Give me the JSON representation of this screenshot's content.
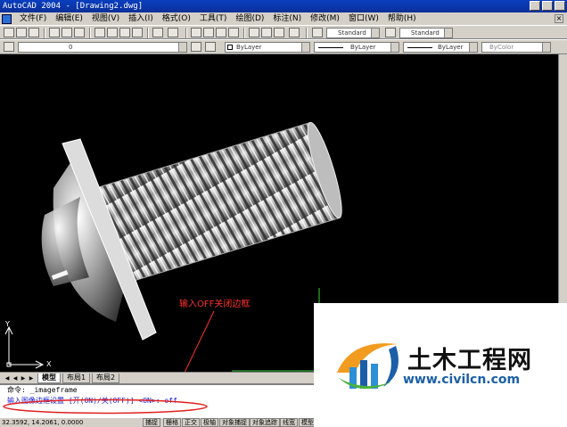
{
  "window": {
    "title": "AutoCAD 2004 - [Drawing2.dwg]"
  },
  "menu": [
    "文件(F)",
    "编辑(E)",
    "视图(V)",
    "插入(I)",
    "格式(O)",
    "工具(T)",
    "绘图(D)",
    "标注(N)",
    "修改(M)",
    "窗口(W)",
    "帮助(H)"
  ],
  "toolbar": {
    "text_style": "Standard",
    "dim_style": "Standard",
    "layer": "0",
    "color": "ByLayer",
    "linetype": "ByLayer",
    "lineweight": "ByLayer",
    "plotstyle": "ByColor"
  },
  "canvas": {
    "annotation": "输入OFF关闭边框",
    "ucs_x": "X",
    "ucs_y": "Y"
  },
  "tabs": [
    "模型",
    "布局1",
    "布局2"
  ],
  "command": {
    "line1": "命令: _imageframe",
    "line2": "输入图像边框设置 [开(ON)/关(OFF)] <ON>: off"
  },
  "status": {
    "coords": "32.3592, 14.2061, 0.0000",
    "buttons": [
      "捕捉",
      "栅格",
      "正交",
      "极轴",
      "对象捕捉",
      "对象追踪",
      "线宽",
      "模型"
    ]
  },
  "watermark": {
    "name": "土木工程网",
    "url": "www.civilcn.com"
  },
  "colors": {
    "annotation": "#ff3030",
    "ellipse": "#e02020",
    "watermark_url": "#1b5fa8"
  }
}
